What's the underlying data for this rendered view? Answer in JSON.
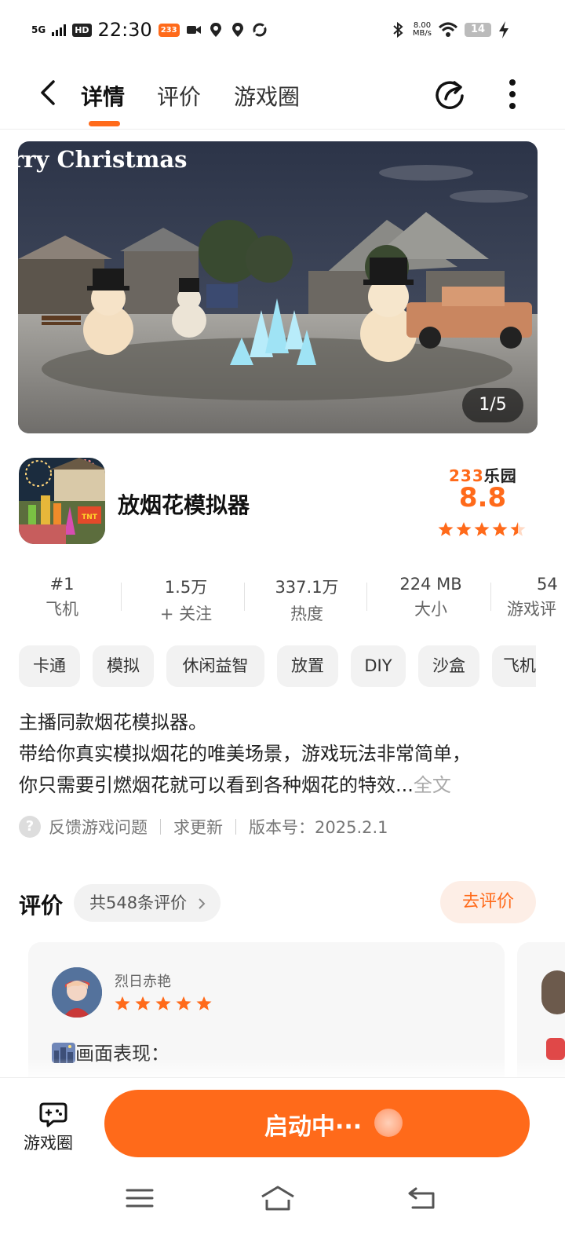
{
  "status_bar": {
    "network": "5G",
    "hd": "HD",
    "time": "22:30",
    "app_badge": "233",
    "speed_value": "8.00",
    "speed_unit": "MB/s",
    "battery": "14"
  },
  "nav": {
    "tabs": [
      {
        "label": "详情"
      },
      {
        "label": "评价"
      },
      {
        "label": "游戏圈"
      }
    ]
  },
  "banner": {
    "title": "rry Christmas",
    "counter": "1/5"
  },
  "app": {
    "name": "放烟花模拟器",
    "icon_badge": "TNT",
    "brand_num": "233",
    "brand_text": "乐园",
    "score": "8.8",
    "rating_stars": 4.5
  },
  "stats": [
    {
      "value": "#1",
      "label": "飞机"
    },
    {
      "value": "1.5万",
      "label": "+ 关注"
    },
    {
      "value": "337.1万",
      "label": "热度"
    },
    {
      "value": "224 MB",
      "label": "大小"
    },
    {
      "value": "54",
      "label": "游戏评"
    }
  ],
  "tags": [
    "卡通",
    "模拟",
    "休闲益智",
    "放置",
    "DIY",
    "沙盒",
    "飞机"
  ],
  "description": {
    "line1": "主播同款烟花模拟器。",
    "line2": "带给你真实模拟烟花的唯美场景，游戏玩法非常简单，",
    "line3": "你只需要引燃烟花就可以看到各种烟花的特效...",
    "more": "全文"
  },
  "feedback": {
    "report": "反馈游戏问题",
    "request_update": "求更新",
    "version": "版本号：2025.2.1"
  },
  "reviews": {
    "title": "评价",
    "count": "共548条评价",
    "write": "去评价",
    "first": {
      "user": "烈日赤艳",
      "stars": 5,
      "text": "画面表现："
    }
  },
  "bottom": {
    "circle_label": "游戏圈",
    "launch_label": "启动中···"
  },
  "colors": {
    "accent": "#ff6a1a",
    "accent_light": "#fdeee6"
  }
}
